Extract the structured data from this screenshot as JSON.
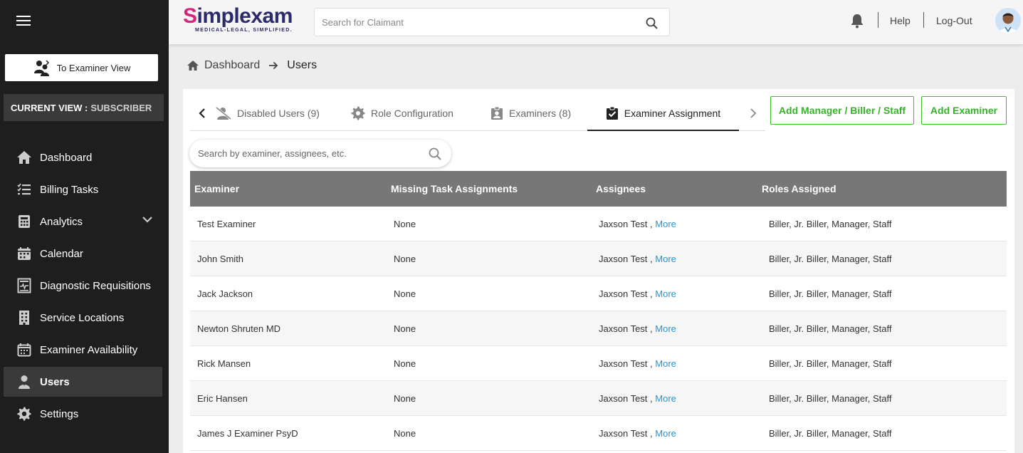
{
  "sidebar": {
    "examiner_view_label": "To Examiner View",
    "current_view_label": "CURRENT VIEW :",
    "current_view_value": "SUBSCRIBER",
    "items": [
      {
        "label": "Dashboard",
        "icon": "home-icon"
      },
      {
        "label": "Billing Tasks",
        "icon": "task-list-icon"
      },
      {
        "label": "Analytics",
        "icon": "calculator-icon"
      },
      {
        "label": "Calendar",
        "icon": "calendar-icon"
      },
      {
        "label": "Diagnostic Requisitions",
        "icon": "requisition-icon"
      },
      {
        "label": "Service Locations",
        "icon": "building-icon"
      },
      {
        "label": "Examiner Availability",
        "icon": "calendar-check-icon"
      },
      {
        "label": "Users",
        "icon": "user-icon"
      },
      {
        "label": "Settings",
        "icon": "gear-icon"
      }
    ],
    "active_item": "Users"
  },
  "topbar": {
    "logo_main_s": "S",
    "logo_main_rest": "implexam",
    "logo_tagline": "MEDICAL-LEGAL, SIMPLIFIED.",
    "search_placeholder": "Search for Claimant",
    "help_label": "Help",
    "logout_label": "Log-Out"
  },
  "breadcrumb": {
    "home": "Dashboard",
    "current": "Users"
  },
  "tabs": [
    {
      "label": "Disabled Users (9)",
      "icon": "user-off-icon"
    },
    {
      "label": "Role Configuration",
      "icon": "gear-icon"
    },
    {
      "label": "Examiners (8)",
      "icon": "badge-icon"
    },
    {
      "label": "Examiner Assignment",
      "icon": "clipboard-check-icon"
    }
  ],
  "active_tab": "Examiner Assignment",
  "buttons": {
    "add_staff": "Add Manager / Biller / Staff",
    "add_examiner": "Add Examiner"
  },
  "table_search_placeholder": "Search by examiner, assignees, etc.",
  "table": {
    "headers": [
      "Examiner",
      "Missing Task Assignments",
      "Assignees",
      "Roles Assigned"
    ],
    "rows": [
      {
        "examiner": "Test  Examiner",
        "missing": "None",
        "assignee": "Jaxson  Test ,",
        "more": "More",
        "roles": "Biller, Jr. Biller, Manager, Staff"
      },
      {
        "examiner": "John  Smith",
        "missing": "None",
        "assignee": "Jaxson  Test ,",
        "more": "More",
        "roles": "Biller, Jr. Biller, Manager, Staff"
      },
      {
        "examiner": "Jack  Jackson",
        "missing": "None",
        "assignee": "Jaxson  Test ,",
        "more": "More",
        "roles": "Biller, Jr. Biller, Manager, Staff"
      },
      {
        "examiner": "Newton  Shruten MD",
        "missing": "None",
        "assignee": "Jaxson  Test ,",
        "more": "More",
        "roles": "Biller, Jr. Biller, Manager, Staff"
      },
      {
        "examiner": "Rick  Mansen",
        "missing": "None",
        "assignee": "Jaxson  Test ,",
        "more": "More",
        "roles": "Biller, Jr. Biller, Manager, Staff"
      },
      {
        "examiner": "Eric  Hansen",
        "missing": "None",
        "assignee": "Jaxson  Test ,",
        "more": "More",
        "roles": "Biller, Jr. Biller, Manager, Staff"
      },
      {
        "examiner": "James J Examiner PsyD",
        "missing": "None",
        "assignee": "Jaxson  Test ,",
        "more": "More",
        "roles": "Biller, Jr. Biller, Manager, Staff"
      }
    ]
  },
  "colors": {
    "sidebar_bg": "#1e1e1e",
    "accent_green": "#35b327",
    "link_blue": "#2a95c9",
    "logo_pink": "#d6247d",
    "logo_navy": "#2b2a6b",
    "table_header_bg": "#777777"
  }
}
